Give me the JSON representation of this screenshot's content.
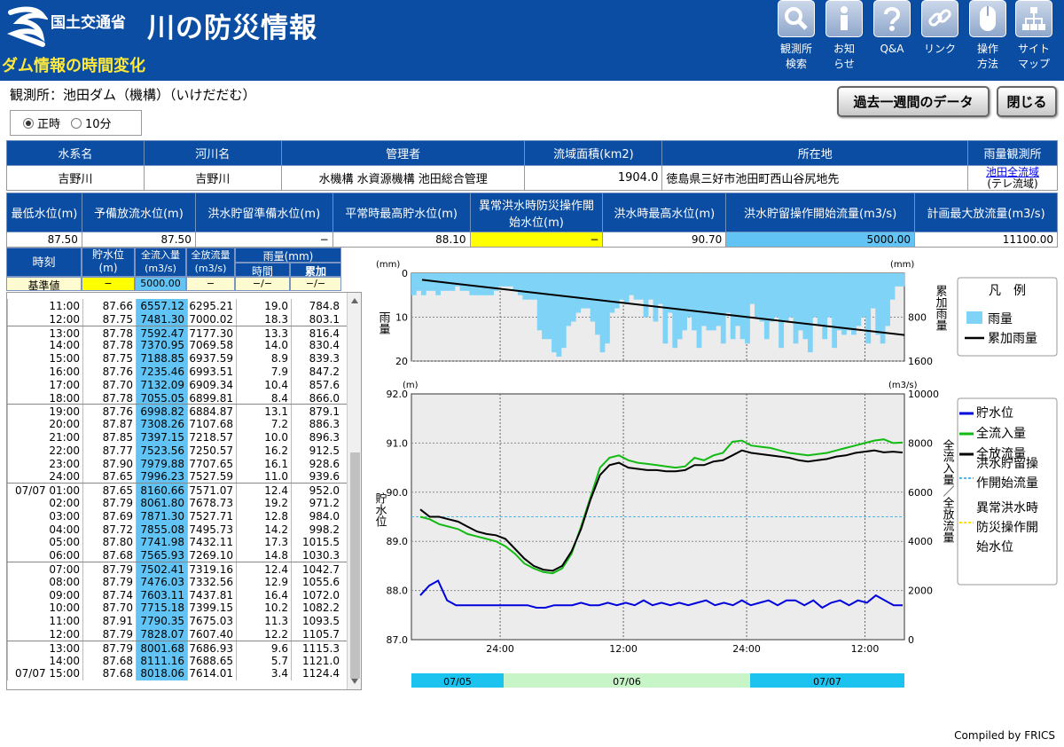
{
  "header": {
    "ministry": "国土交通省",
    "site_title": "川の防災情報",
    "page_subtitle": "ダム情報の時間変化",
    "nav": [
      {
        "l1": "観測所",
        "l2": "検索",
        "icon": "magnifier-icon"
      },
      {
        "l1": "お知",
        "l2": "らせ",
        "icon": "info-icon"
      },
      {
        "l1": "Q&A",
        "l2": "",
        "icon": "question-icon"
      },
      {
        "l1": "リンク",
        "l2": "",
        "icon": "link-icon"
      },
      {
        "l1": "操作",
        "l2": "方法",
        "icon": "mouse-icon"
      },
      {
        "l1": "サイト",
        "l2": "マップ",
        "icon": "sitemap-icon"
      }
    ]
  },
  "station": {
    "label": "観測所：池田ダム（機構）（いけだだむ）",
    "mode_hourly": "正時",
    "mode_10min": "10分",
    "btn_week": "過去一週間のデータ",
    "btn_close": "閉じる"
  },
  "info1": {
    "headers": [
      "水系名",
      "河川名",
      "管理者",
      "流域面積(km2)",
      "所在地",
      "雨量観測所"
    ],
    "values": [
      "吉野川",
      "吉野川",
      "水機構  水資源機構  池田総合管理",
      "1904.0",
      "徳島県三好市池田町西山谷尻地先"
    ],
    "rain_station_link": "池田全流域",
    "rain_station_sub": "(テレ流域)"
  },
  "info2": {
    "headers": [
      "最低水位(m)",
      "予備放流水位(m)",
      "洪水貯留準備水位(m)",
      "平常時最高貯水位(m)",
      "異常洪水時防災操作開始水位(m)",
      "洪水時最高水位(m)",
      "洪水貯留操作開始流量(m3/s)",
      "計画最大放流量(m3/s)"
    ],
    "values": [
      "87.50",
      "87.50",
      "−",
      "88.10",
      "−",
      "90.70",
      "5000.00",
      "11100.00"
    ]
  },
  "table": {
    "h_time": "時刻",
    "h_level": "貯水位",
    "h_level_unit": "(m)",
    "h_inflow": "全流入量",
    "h_outflow": "全放流量",
    "h_flow_unit": "(m3/s)",
    "h_rain": "雨量(mm)",
    "h_rain_hour": "時間",
    "h_rain_cum": "累加",
    "base_label": "基準値",
    "base_values": [
      "−",
      "5000.00",
      "−",
      "−/−",
      "−/−"
    ],
    "rows": [
      [
        "11:00",
        "87.66",
        "6557.12",
        "6295.21",
        "19.0",
        "784.8"
      ],
      [
        "12:00",
        "87.75",
        "7481.30",
        "7000.02",
        "18.3",
        "803.1"
      ],
      [
        "13:00",
        "87.78",
        "7592.47",
        "7177.30",
        "13.3",
        "816.4"
      ],
      [
        "14:00",
        "87.78",
        "7370.95",
        "7069.58",
        "14.0",
        "830.4"
      ],
      [
        "15:00",
        "87.75",
        "7188.85",
        "6937.59",
        "8.9",
        "839.3"
      ],
      [
        "16:00",
        "87.76",
        "7235.46",
        "6993.51",
        "7.9",
        "847.2"
      ],
      [
        "17:00",
        "87.70",
        "7132.09",
        "6909.34",
        "10.4",
        "857.6"
      ],
      [
        "18:00",
        "87.78",
        "7055.05",
        "6899.81",
        "8.4",
        "866.0"
      ],
      [
        "19:00",
        "87.76",
        "6998.82",
        "6884.87",
        "13.1",
        "879.1"
      ],
      [
        "20:00",
        "87.87",
        "7308.26",
        "7107.68",
        "7.2",
        "886.3"
      ],
      [
        "21:00",
        "87.85",
        "7397.15",
        "7218.57",
        "10.0",
        "896.3"
      ],
      [
        "22:00",
        "87.77",
        "7523.56",
        "7250.57",
        "16.2",
        "912.5"
      ],
      [
        "23:00",
        "87.90",
        "7979.88",
        "7707.65",
        "16.1",
        "928.6"
      ],
      [
        "24:00",
        "87.65",
        "7996.23",
        "7527.59",
        "11.0",
        "939.6"
      ],
      [
        "07/07 01:00",
        "87.65",
        "8160.66",
        "7571.07",
        "12.4",
        "952.0"
      ],
      [
        "02:00",
        "87.79",
        "8061.80",
        "7678.73",
        "19.2",
        "971.2"
      ],
      [
        "03:00",
        "87.69",
        "7871.30",
        "7527.71",
        "12.8",
        "984.0"
      ],
      [
        "04:00",
        "87.72",
        "7855.08",
        "7495.73",
        "14.2",
        "998.2"
      ],
      [
        "05:00",
        "87.80",
        "7741.98",
        "7432.11",
        "17.3",
        "1015.5"
      ],
      [
        "06:00",
        "87.68",
        "7565.93",
        "7269.10",
        "14.8",
        "1030.3"
      ],
      [
        "07:00",
        "87.79",
        "7502.41",
        "7319.16",
        "12.4",
        "1042.7"
      ],
      [
        "08:00",
        "87.79",
        "7476.03",
        "7332.56",
        "12.9",
        "1055.6"
      ],
      [
        "09:00",
        "87.74",
        "7603.11",
        "7437.81",
        "16.4",
        "1072.0"
      ],
      [
        "10:00",
        "87.70",
        "7715.18",
        "7399.15",
        "10.2",
        "1082.2"
      ],
      [
        "11:00",
        "87.91",
        "7790.35",
        "7675.03",
        "11.3",
        "1093.5"
      ],
      [
        "12:00",
        "87.79",
        "7828.07",
        "7607.40",
        "12.2",
        "1105.7"
      ],
      [
        "13:00",
        "87.79",
        "8001.68",
        "7686.93",
        "9.6",
        "1115.3"
      ],
      [
        "14:00",
        "87.68",
        "8111.16",
        "7688.65",
        "5.7",
        "1121.0"
      ],
      [
        "07/07 15:00",
        "87.68",
        "8018.06",
        "7614.01",
        "3.4",
        "1124.4"
      ]
    ]
  },
  "chart_data": [
    {
      "type": "bar",
      "name": "rain",
      "left_unit": "(mm)",
      "right_unit": "(mm)",
      "left_label": "雨量",
      "right_label": "累加雨量",
      "left_ticks": [
        "0",
        "10",
        "20"
      ],
      "right_ticks": [
        "800",
        "1600"
      ],
      "left_range": [
        0,
        20
      ],
      "right_range": [
        0,
        1600
      ],
      "series": [
        {
          "name": "雨量",
          "color": "#7fd3f7"
        },
        {
          "name": "累加雨量",
          "color": "#000000"
        }
      ],
      "rain_values": [
        5,
        4,
        5,
        4,
        4,
        5,
        4,
        4,
        4,
        3,
        4,
        4,
        5,
        5,
        5,
        5,
        5,
        4,
        3,
        3,
        3,
        4,
        5,
        6,
        6,
        6,
        13,
        15,
        15,
        18,
        19,
        17,
        12,
        11,
        9,
        8,
        8,
        11,
        14,
        18,
        16,
        9,
        8,
        6,
        7,
        5,
        6,
        6,
        10,
        6,
        11,
        7,
        16,
        9,
        17,
        15,
        13,
        10,
        13,
        17,
        12,
        13,
        13,
        12,
        16,
        9,
        15,
        12,
        15,
        16,
        7,
        10,
        11,
        15,
        11,
        10,
        17,
        11,
        10,
        16,
        13,
        15,
        18,
        10,
        12,
        15,
        10,
        17,
        13,
        14,
        13,
        14,
        12,
        10,
        16,
        8,
        14,
        16,
        12,
        6,
        3,
        3
      ],
      "cum_start": 120,
      "cum_end": 1124.4
    },
    {
      "type": "line",
      "name": "dam",
      "left_unit": "(m)",
      "right_unit": "(m3/s)",
      "left_label": "貯水位",
      "right_label": "全流入量／全放流量",
      "left_ticks": [
        "92.0",
        "91.0",
        "90.0",
        "89.0",
        "88.0",
        "87.0"
      ],
      "right_ticks": [
        "10000",
        "8000",
        "6000",
        "4000",
        "2000",
        "0"
      ],
      "left_range": [
        87.0,
        92.0
      ],
      "right_range": [
        0,
        10000
      ],
      "x_ticks": [
        "24:00",
        "12:00",
        "24:00",
        "12:00"
      ],
      "date_labels": [
        "07/05",
        "07/06",
        "07/07"
      ],
      "reference_flow": 5000,
      "series": [
        {
          "name": "貯水位",
          "color": "#0000dd",
          "values": [
            87.9,
            88.1,
            88.2,
            87.8,
            87.7,
            87.7,
            87.7,
            87.7,
            87.7,
            87.7,
            87.7,
            87.7,
            87.7,
            87.65,
            87.65,
            87.7,
            87.7,
            87.7,
            87.75,
            87.7,
            87.7,
            87.75,
            87.7,
            87.75,
            87.7,
            87.8,
            87.7,
            87.75,
            87.7,
            87.75,
            87.7,
            87.75,
            87.8,
            87.7,
            87.75,
            87.7,
            87.8,
            87.7,
            87.75,
            87.8,
            87.7,
            87.8,
            87.8,
            87.7,
            87.8,
            87.65,
            87.75,
            87.8,
            87.7,
            87.8,
            87.75,
            87.9,
            87.8,
            87.7,
            87.7
          ]
        },
        {
          "name": "全流入量",
          "color": "#11bb11",
          "values": [
            5000,
            4900,
            4700,
            4600,
            4500,
            4300,
            4200,
            4100,
            4000,
            3800,
            3500,
            3100,
            2900,
            2750,
            2700,
            2900,
            3500,
            4600,
            5800,
            7000,
            7400,
            7500,
            7300,
            7200,
            7150,
            7100,
            7050,
            7000,
            7050,
            7400,
            7300,
            7500,
            7600,
            8050,
            8100,
            7900,
            7850,
            7800,
            7700,
            7600,
            7550,
            7500,
            7550,
            7600,
            7700,
            7800,
            7900,
            8000,
            8100,
            8150,
            8000,
            8020
          ]
        },
        {
          "name": "全放流量",
          "color": "#000000",
          "values": [
            5300,
            5000,
            5000,
            4900,
            4800,
            4600,
            4400,
            4300,
            4250,
            4100,
            3700,
            3300,
            3000,
            2850,
            2800,
            3000,
            3600,
            4500,
            5700,
            6700,
            7100,
            7200,
            7000,
            6950,
            6900,
            6900,
            6850,
            6850,
            6900,
            7100,
            7100,
            7250,
            7300,
            7500,
            7700,
            7600,
            7550,
            7500,
            7450,
            7400,
            7300,
            7250,
            7300,
            7350,
            7450,
            7500,
            7600,
            7650,
            7700,
            7620,
            7650,
            7614
          ]
        }
      ]
    }
  ],
  "legend1": {
    "title": "凡　例",
    "items": [
      "雨量",
      "累加雨量"
    ]
  },
  "legend2": {
    "items": [
      "貯水位",
      "全流入量",
      "全放流量",
      "洪水貯留操作開始流量",
      "異常洪水時防災操作開始水位"
    ]
  },
  "colors": {
    "header_bg": "#0a4da2",
    "header_title": "#ffe83c",
    "inflow_cell": "#62c4f4",
    "date_bar_day1": "#1cc3ef",
    "date_bar_day2": "#c8f5c8"
  },
  "footer": "Compiled by FRICS"
}
